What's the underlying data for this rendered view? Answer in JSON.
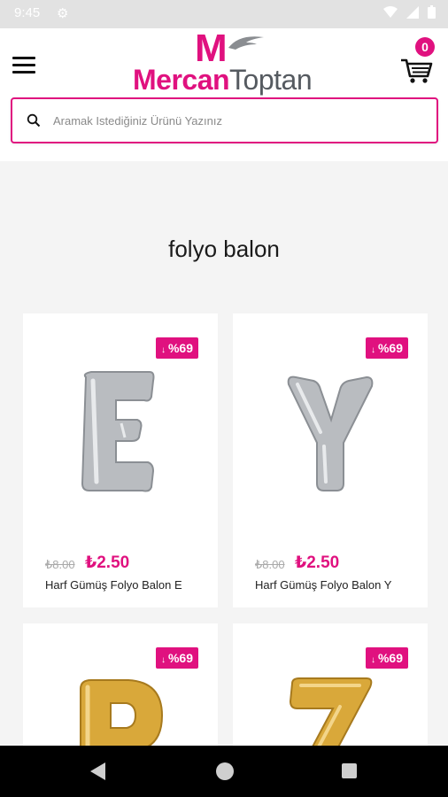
{
  "status_bar": {
    "time": "9:45"
  },
  "header": {
    "logo_mark": "M",
    "logo_part1": "Mercan",
    "logo_part2": "Toptan",
    "cart_count": "0"
  },
  "search": {
    "placeholder": "Aramak Istediğiniz Ürünü Yazınız",
    "value": ""
  },
  "page_title": "folyo balon",
  "colors": {
    "brand": "#e0117f",
    "silver": "#b9bcc0",
    "gold": "#d9a83a"
  },
  "products": [
    {
      "discount": "%69",
      "old_price": "₺8.00",
      "price": "₺2.50",
      "name": "Harf Gümüş Folyo Balon E",
      "letter": "E",
      "color": "silver"
    },
    {
      "discount": "%69",
      "old_price": "₺8.00",
      "price": "₺2.50",
      "name": "Harf Gümüş Folyo Balon Y",
      "letter": "Y",
      "color": "silver"
    },
    {
      "discount": "%69",
      "letter": "P",
      "color": "gold"
    },
    {
      "discount": "%69",
      "letter": "Z",
      "color": "gold"
    }
  ]
}
